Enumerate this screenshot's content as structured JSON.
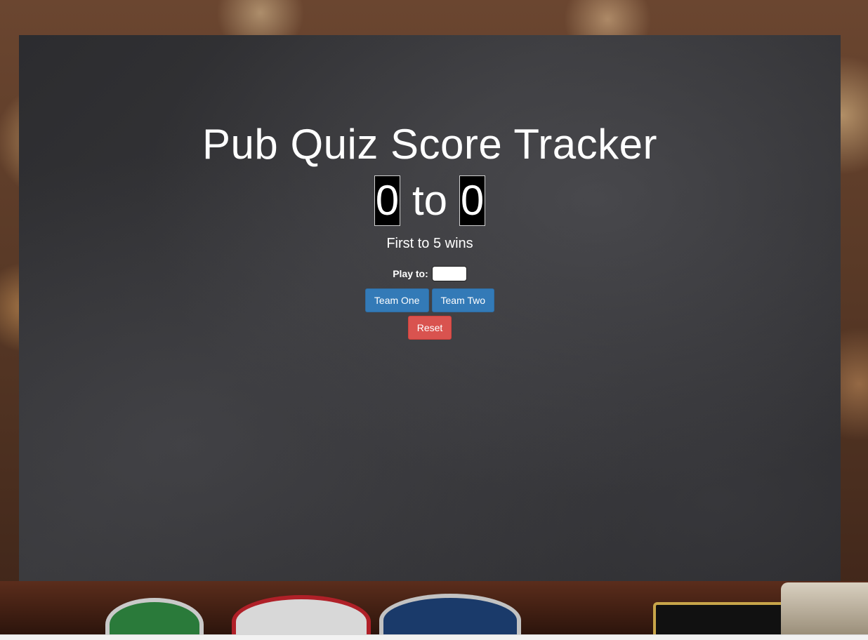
{
  "app": {
    "title": "Pub Quiz Score Tracker"
  },
  "score": {
    "team_one": "0",
    "separator": "to",
    "team_two": "0"
  },
  "status": {
    "message": "First to 5 wins"
  },
  "play_to": {
    "label": "Play to:",
    "value": ""
  },
  "buttons": {
    "team_one": "Team One",
    "team_two": "Team Two",
    "reset": "Reset"
  },
  "colors": {
    "primary": "#337ab7",
    "danger": "#d9534f",
    "chalkboard": "#2e2e31",
    "text": "#ffffff"
  }
}
